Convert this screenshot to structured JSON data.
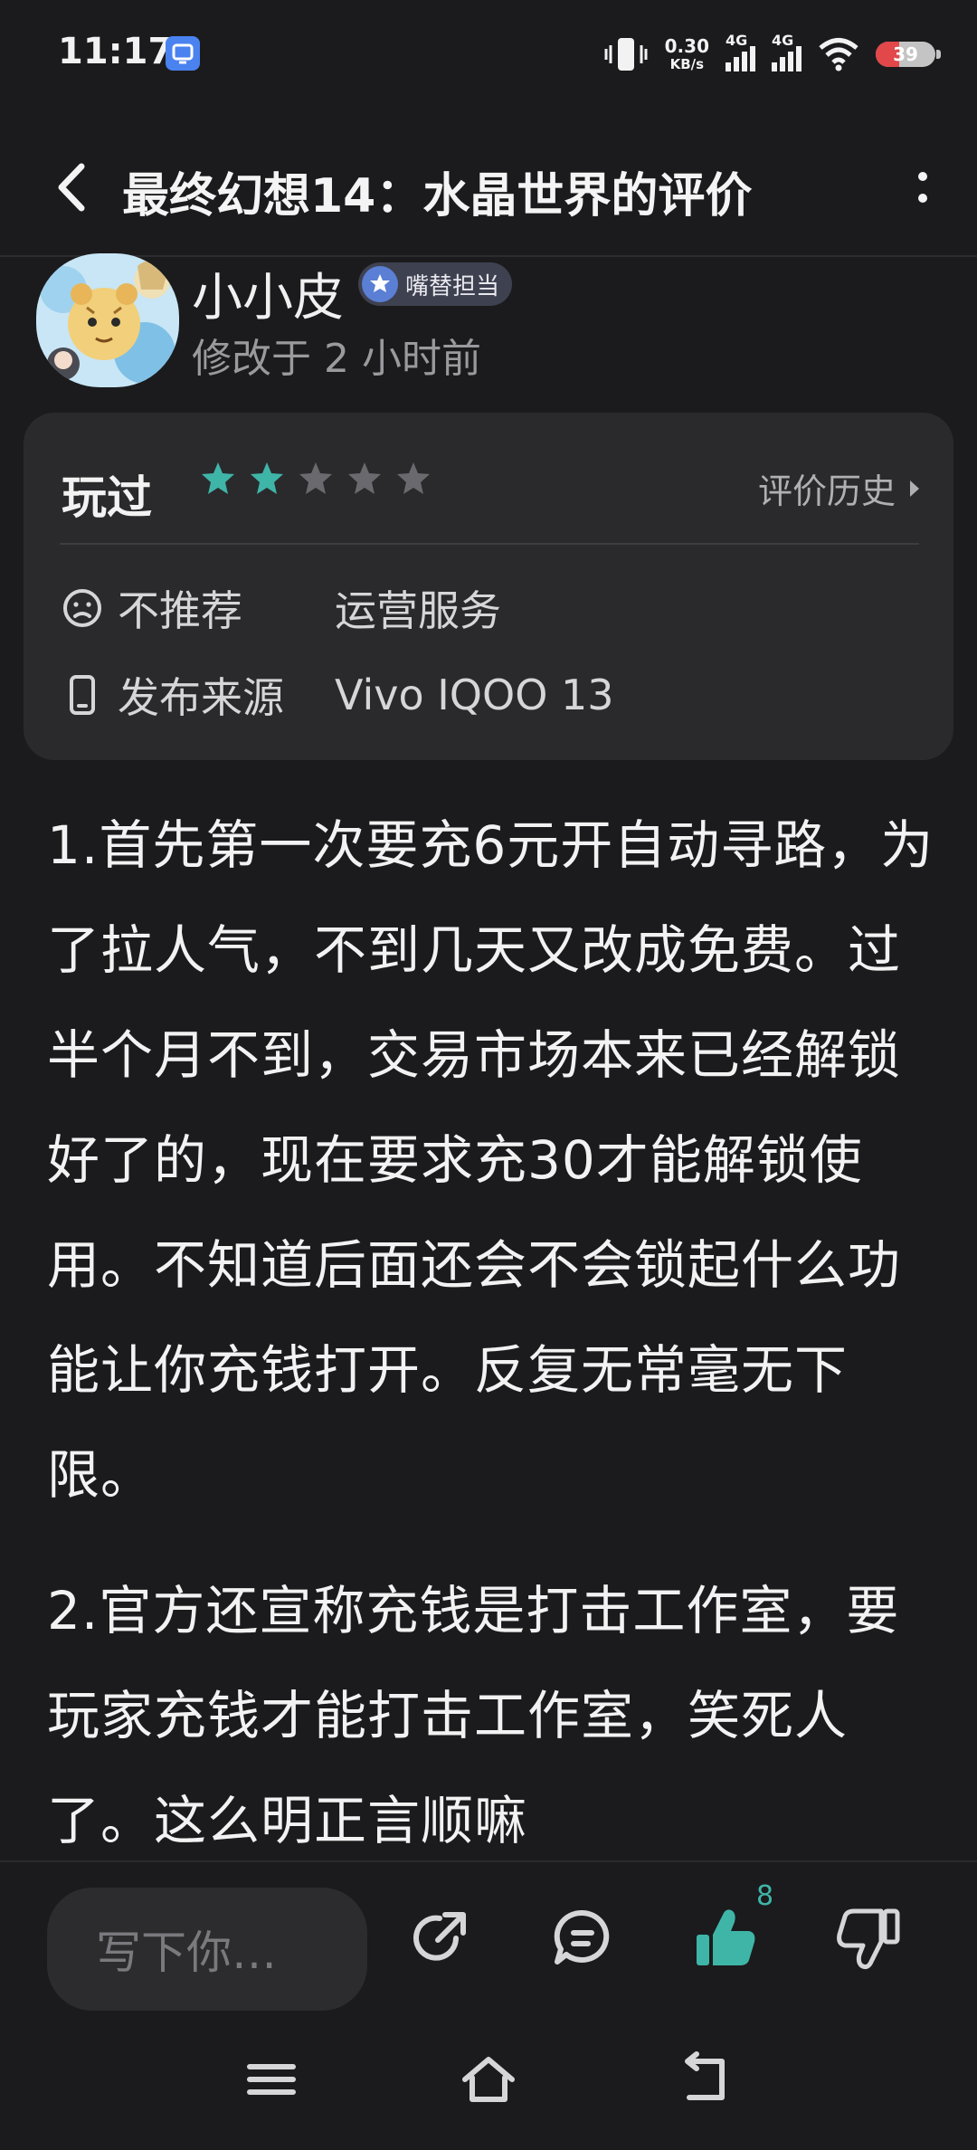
{
  "status_bar": {
    "time": "11:17",
    "net_speed_value": "0.30",
    "net_speed_unit": "KB/s",
    "signal1_label": "4G",
    "signal2_label": "4G",
    "battery_level": "39"
  },
  "app_bar": {
    "title": "最终幻想14：水晶世界的评价"
  },
  "author": {
    "name": "小小皮",
    "badge": "嘴替担当",
    "modified_time": "修改于 2 小时前"
  },
  "card": {
    "played_label": "玩过",
    "rating": 2,
    "rating_max": 5,
    "history_label": "评价历史",
    "tag_key": "不推荐",
    "tag_value": "运营服务",
    "source_key": "发布来源",
    "source_value": "Vivo IQOO 13"
  },
  "review": {
    "paragraphs": [
      "1.首先第一次要充6元开自动寻路，为了拉人气，不到几天又改成免费。过半个月不到，交易市场本来已经解锁好了的，现在要求充30才能解锁使用。不知道后面还会不会锁起什么功能让你充钱打开。反复无常毫无下限。",
      "2.官方还宣称充钱是打击工作室，要玩家充钱才能打击工作室，笑死人了。这么明正言顺嘛"
    ]
  },
  "bottom_bar": {
    "comment_placeholder": "写下你…",
    "like_count": "8"
  },
  "colors": {
    "background": "#1b1b1d",
    "card": "#2a2a2d",
    "accent_teal": "#3fb5a8",
    "text_primary": "#f2f2f2",
    "text_secondary": "#9a9a9e"
  }
}
